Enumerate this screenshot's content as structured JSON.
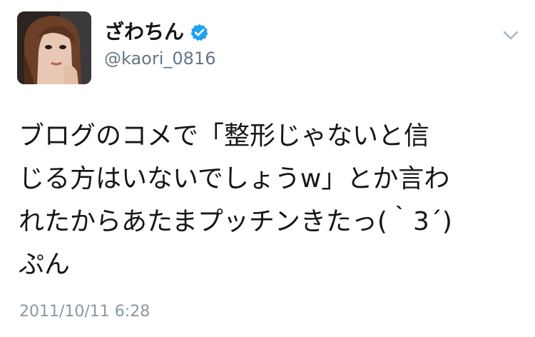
{
  "user": {
    "display_name": "ざわちん",
    "handle": "@kaori_0816",
    "verified": true
  },
  "icons": {
    "verified": "verified-badge-icon",
    "more": "chevron-down-icon"
  },
  "tweet": {
    "lines": [
      "ブログのコメで「整形じゃないと信",
      "じる方はいないでしょうw」とか言わ",
      "れたからあたまプッチンきたっ(｀3´)",
      "ぷん"
    ],
    "timestamp": "2011/10/11 6:28"
  },
  "colors": {
    "name": "#14171a",
    "handle": "#657786",
    "timestamp": "#8899a6",
    "verified": "#1da1f2",
    "chevron": "#aab8c2"
  }
}
